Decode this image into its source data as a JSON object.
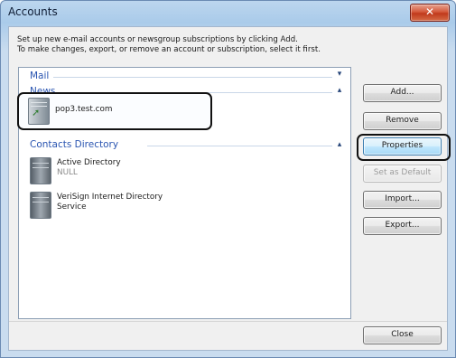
{
  "window": {
    "title": "Accounts",
    "close_glyph": "✕"
  },
  "description": {
    "line1": "Set up new e-mail accounts or newsgroup subscriptions by clicking Add.",
    "line2": "To make changes, export, or remove an account or subscription, select it first."
  },
  "groups": [
    {
      "label": "Mail",
      "chevron": "▾"
    },
    {
      "label": "News",
      "chevron": "▴"
    },
    {
      "label": "Contacts Directory",
      "chevron": "▴"
    }
  ],
  "news_items": [
    {
      "label": "pop3.test.com",
      "icon": "news-account-icon"
    }
  ],
  "directory_items": [
    {
      "label": "Active Directory",
      "sub": "NULL",
      "icon": "directory-server-icon"
    },
    {
      "label": "VeriSign Internet Directory",
      "sub": "Service",
      "icon": "directory-server-icon"
    }
  ],
  "buttons": {
    "add": "Add...",
    "remove": "Remove",
    "properties": "Properties",
    "set_default": "Set as Default",
    "import": "Import...",
    "export": "Export...",
    "close": "Close"
  },
  "colors": {
    "group_header": "#2a55b1",
    "title_bar": "#aacbea",
    "close_button": "#c0391c"
  }
}
